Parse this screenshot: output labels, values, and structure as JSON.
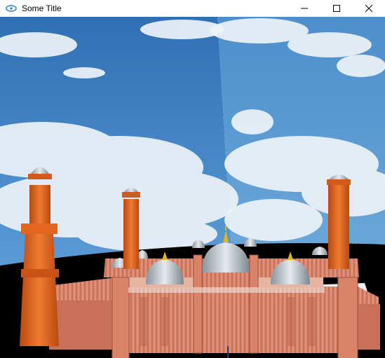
{
  "window": {
    "title": "Some Title",
    "controls": [
      "minimize-icon",
      "maximize-icon",
      "close-icon"
    ]
  },
  "scene": {
    "icon": "opengl-scene",
    "colors": {
      "sky": "#3f84c8",
      "cloud": "#eef3f8",
      "sandstone": "#d9826a",
      "minaret": "#e2661f",
      "dome": "#c7cfd6",
      "finial": "#e2b21a",
      "ground": "#000000"
    }
  }
}
